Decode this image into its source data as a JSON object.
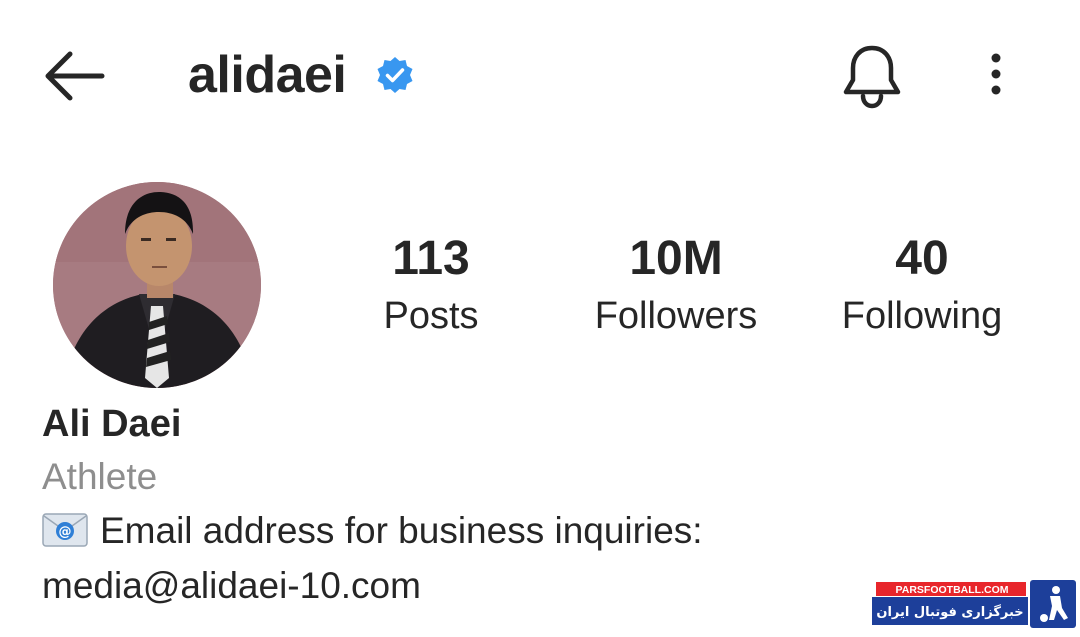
{
  "header": {
    "username": "alidaei",
    "icons": {
      "back": "arrow-left-icon",
      "verified": "verified-badge-icon",
      "notifications": "bell-icon",
      "more": "more-vertical-icon"
    }
  },
  "stats": [
    {
      "value": "113",
      "label": "Posts"
    },
    {
      "value": "10M",
      "label": "Followers"
    },
    {
      "value": "40",
      "label": "Following"
    }
  ],
  "bio": {
    "full_name": "Ali Daei",
    "category": "Athlete",
    "line1_text": "Email address for business inquiries:",
    "line2_text": "media@alidaei-10.com",
    "emoji": "email-emoji-icon"
  },
  "watermark": {
    "site": "PARSFOOTBALL.COM",
    "tagline": "خبرگزاری فوتبال ایران"
  },
  "colors": {
    "text": "#262626",
    "secondary": "#8e8e8e",
    "verified_blue": "#3897f0",
    "watermark_red": "#e8262b",
    "watermark_blue": "#1d3f9a"
  }
}
